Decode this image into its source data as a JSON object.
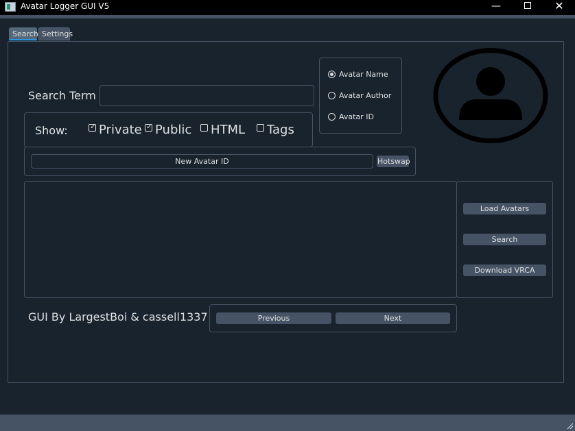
{
  "window": {
    "title": "Avatar Logger GUI V5",
    "minimize_icon": "—",
    "close_icon": "✕"
  },
  "tabs": [
    {
      "label": "Search",
      "active": true
    },
    {
      "label": "Settings",
      "active": false
    }
  ],
  "search": {
    "label": "Search Term",
    "value": ""
  },
  "search_type": {
    "options": [
      {
        "label": "Avatar Name",
        "selected": true
      },
      {
        "label": "Avatar Author",
        "selected": false
      },
      {
        "label": "Avatar ID",
        "selected": false
      }
    ]
  },
  "show_filters": {
    "label": "Show:",
    "options": [
      {
        "label": "Private",
        "checked": true
      },
      {
        "label": "Public",
        "checked": true
      },
      {
        "label": "HTML",
        "checked": false
      },
      {
        "label": "Tags",
        "checked": false
      }
    ]
  },
  "hotswap": {
    "new_avatar_id_label": "New Avatar ID",
    "hotswap_label": "Hotswap"
  },
  "actions": {
    "load_avatars": "Load Avatars",
    "search": "Search",
    "download_vrca": "Download VRCA"
  },
  "credits": "GUI By LargestBoi & cassell1337",
  "pagination": {
    "previous": "Previous",
    "next": "Next"
  },
  "colors": {
    "background": "#19232d",
    "border": "#455364",
    "button": "#455364",
    "accent": "#259ae9",
    "text": "#dfe1e2"
  },
  "icons": {
    "app": "app-icon",
    "avatar": "user-placeholder-icon"
  }
}
